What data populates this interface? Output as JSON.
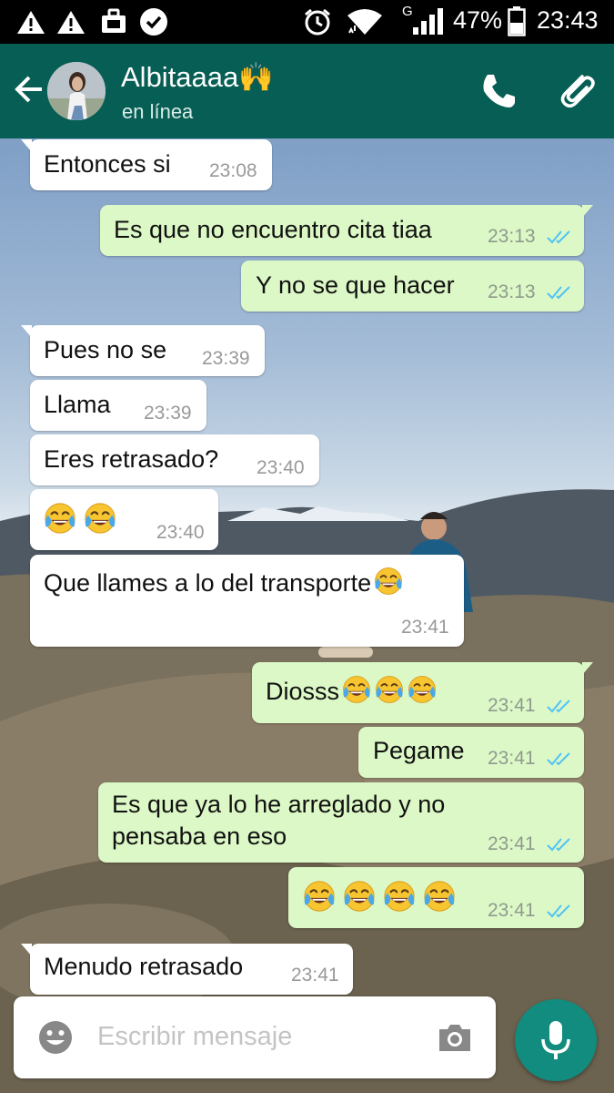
{
  "status_bar": {
    "battery_percent": "47%",
    "time": "23:43",
    "network": "G",
    "icons": [
      "warning-icon",
      "warning-icon",
      "briefcase-icon",
      "check-badge-icon",
      "alarm-icon",
      "wifi-icon",
      "signal-icon",
      "battery-icon"
    ]
  },
  "header": {
    "contact_name": "Albitaaaa🙌",
    "status": "en línea",
    "icons": [
      "back-arrow-icon",
      "avatar",
      "phone-icon",
      "paperclip-icon"
    ]
  },
  "messages": [
    {
      "dir": "in",
      "text": "Entonces si",
      "time": "23:08"
    },
    {
      "dir": "out",
      "text": "Es que no encuentro  cita tiaa",
      "time": "23:13"
    },
    {
      "dir": "out",
      "text": "Y no se que hacer",
      "time": "23:13"
    },
    {
      "dir": "in",
      "text": "Pues no se",
      "time": "23:39"
    },
    {
      "dir": "in",
      "text": "Llama",
      "time": "23:39"
    },
    {
      "dir": "in",
      "text": "Eres retrasado?",
      "time": "23:40"
    },
    {
      "dir": "in",
      "text": "",
      "emoji_count": 2,
      "time": "23:40"
    },
    {
      "dir": "in",
      "text": "Que llames a lo del transporte",
      "emoji_count": 1,
      "time": "23:41"
    },
    {
      "dir": "out",
      "text": "Diosss",
      "emoji_count": 3,
      "time": "23:41"
    },
    {
      "dir": "out",
      "text": "Pegame",
      "time": "23:41"
    },
    {
      "dir": "out",
      "text": "Es que ya lo he arreglado y no",
      "text2": "pensaba en eso",
      "time": "23:41"
    },
    {
      "dir": "out",
      "text": "",
      "emoji_count": 4,
      "time": "23:41"
    },
    {
      "dir": "in",
      "text": "Menudo retrasado",
      "time": "23:41"
    }
  ],
  "composer": {
    "placeholder": "Escribir mensaje",
    "icons": [
      "emoji-icon",
      "camera-icon",
      "microphone-icon"
    ]
  },
  "colors": {
    "app_bar": "#075e54",
    "incoming_bubble": "#ffffff",
    "outgoing_bubble": "#dcf8c6",
    "read_ticks": "#4fc3f7",
    "mic_button": "#128c7e"
  }
}
